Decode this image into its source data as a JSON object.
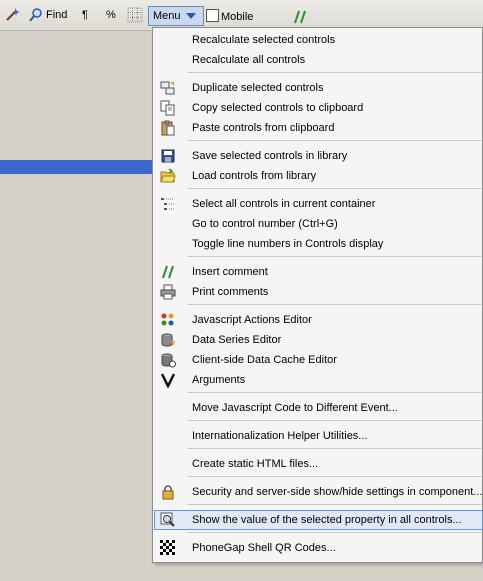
{
  "toolbar": {
    "find_label": "Find",
    "pilcrow_label": "¶",
    "percent_label": "%",
    "menu_label": "Menu",
    "mobile_label": "Mobile"
  },
  "menu": {
    "items": [
      {
        "label": "Recalculate selected controls",
        "icon": "none"
      },
      {
        "label": "Recalculate all controls",
        "icon": "none"
      },
      {
        "label": "Duplicate selected controls",
        "icon": "duplicate-icon"
      },
      {
        "label": "Copy selected controls to clipboard",
        "icon": "copy-icon"
      },
      {
        "label": "Paste controls from clipboard",
        "icon": "paste-icon"
      },
      {
        "label": "Save selected controls in library",
        "icon": "save-disk-icon"
      },
      {
        "label": "Load controls from library",
        "icon": "open-folder-icon"
      },
      {
        "label": "Select all controls in current container",
        "icon": "tree-list-icon"
      },
      {
        "label": "Go to control number (Ctrl+G)",
        "icon": "none"
      },
      {
        "label": "Toggle line numbers in Controls display",
        "icon": "none"
      },
      {
        "label": "Insert comment",
        "icon": "comment-slash-icon"
      },
      {
        "label": "Print comments",
        "icon": "printer-icon"
      },
      {
        "label": "Javascript Actions Editor",
        "icon": "javascript-actions-icon"
      },
      {
        "label": "Data Series Editor",
        "icon": "database-icon"
      },
      {
        "label": "Client-side Data Cache Editor",
        "icon": "database-cache-icon"
      },
      {
        "label": "Arguments",
        "icon": "v-letter-icon"
      },
      {
        "label": "Move Javascript Code to Different Event...",
        "icon": "none"
      },
      {
        "label": "Internationalization Helper Utilities...",
        "icon": "none"
      },
      {
        "label": "Create static HTML files...",
        "icon": "none"
      },
      {
        "label": "Security and server-side show/hide settings in component...",
        "icon": "lock-icon"
      },
      {
        "label": "Show the value of the selected property in all controls...",
        "icon": "magnifier-icon"
      },
      {
        "label": "PhoneGap Shell QR Codes...",
        "icon": "qr-code-icon"
      }
    ]
  },
  "colors": {
    "selection_blue": "#3d69ce",
    "highlight_fill": "#e1e9f7",
    "menu_button": "#c9d8ef"
  }
}
